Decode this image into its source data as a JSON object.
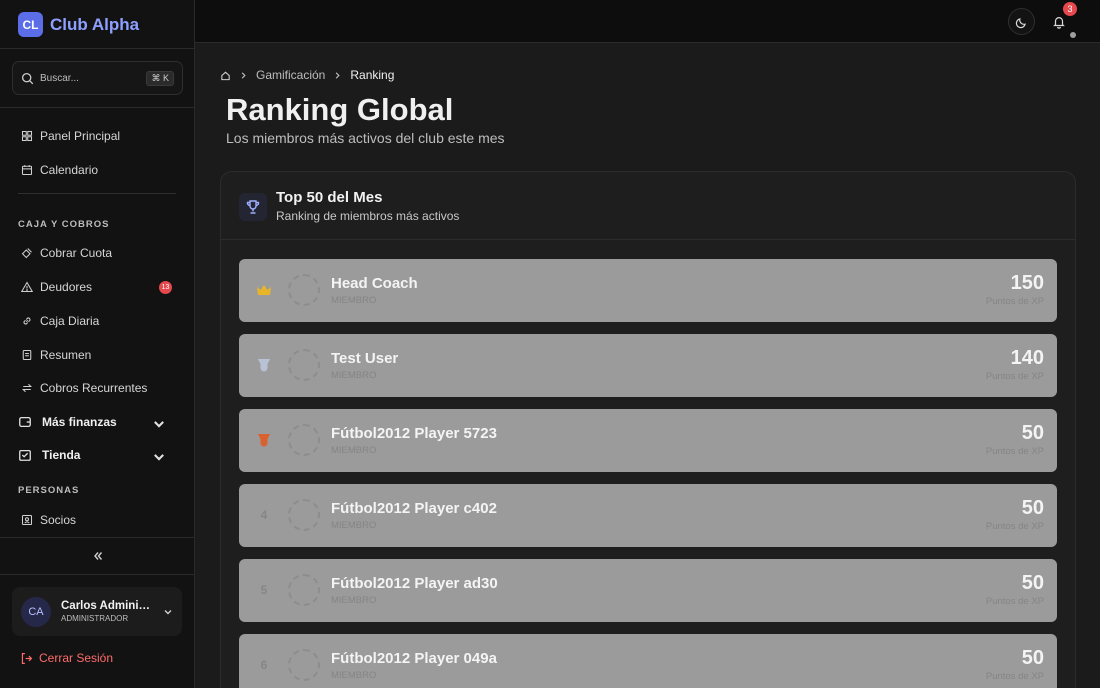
{
  "brand": {
    "logo": "CL",
    "name": "Club Alpha"
  },
  "search": {
    "placeholder": "Buscar...",
    "shortcut": "⌘ K"
  },
  "sidebar": {
    "top_items": [
      {
        "label": "Panel Principal",
        "icon": "grid-icon"
      },
      {
        "label": "Calendario",
        "icon": "calendar-icon"
      }
    ],
    "section_caja": "CAJA Y COBROS",
    "caja_items": [
      {
        "label": "Cobrar Cuota",
        "icon": "wallet-icon"
      },
      {
        "label": "Deudores",
        "icon": "warning-icon",
        "badge": "13"
      },
      {
        "label": "Caja Diaria",
        "icon": "link-icon"
      },
      {
        "label": "Resumen",
        "icon": "receipt-icon"
      },
      {
        "label": "Cobros Recurrentes",
        "icon": "refresh-icon"
      }
    ],
    "groups": [
      {
        "label": "Más finanzas",
        "icon": "wallet-icon"
      },
      {
        "label": "Tienda",
        "icon": "store-icon"
      }
    ],
    "section_personas": "PERSONAS",
    "personas_items": [
      {
        "label": "Socios",
        "icon": "id-card-icon"
      }
    ]
  },
  "user": {
    "initials": "CA",
    "name": "Carlos Administrador",
    "role": "ADMINISTRADOR"
  },
  "logout_label": "Cerrar Sesión",
  "topbar": {
    "notification_count": "3"
  },
  "breadcrumb": {
    "items": [
      "Gamificación",
      "Ranking"
    ]
  },
  "page": {
    "title": "Ranking Global",
    "subtitle": "Los miembros más activos del club este mes"
  },
  "card": {
    "title": "Top 50 del Mes",
    "subtitle": "Ranking de miembros más activos"
  },
  "ranking": [
    {
      "rank": "1",
      "medal": "crown-icon",
      "medal_color": "#e8b52a",
      "name": "Head Coach",
      "role": "MIEMBRO",
      "xp": "150",
      "xp_label": "Puntos de XP"
    },
    {
      "rank": "2",
      "medal": "medal-icon",
      "medal_color": "#b9c2d4",
      "name": "Test User",
      "role": "MIEMBRO",
      "xp": "140",
      "xp_label": "Puntos de XP"
    },
    {
      "rank": "3",
      "medal": "medal-icon",
      "medal_color": "#d9602f",
      "name": "Fútbol2012 Player 5723",
      "role": "MIEMBRO",
      "xp": "50",
      "xp_label": "Puntos de XP"
    },
    {
      "rank": "4",
      "name": "Fútbol2012 Player c402",
      "role": "MIEMBRO",
      "xp": "50",
      "xp_label": "Puntos de XP"
    },
    {
      "rank": "5",
      "name": "Fútbol2012 Player ad30",
      "role": "MIEMBRO",
      "xp": "50",
      "xp_label": "Puntos de XP"
    },
    {
      "rank": "6",
      "name": "Fútbol2012 Player 049a",
      "role": "MIEMBRO",
      "xp": "50",
      "xp_label": "Puntos de XP"
    }
  ],
  "colors": {
    "accent": "#8ea0ff",
    "danger": "#e5484d",
    "row_bg": "#9b9b9b"
  }
}
